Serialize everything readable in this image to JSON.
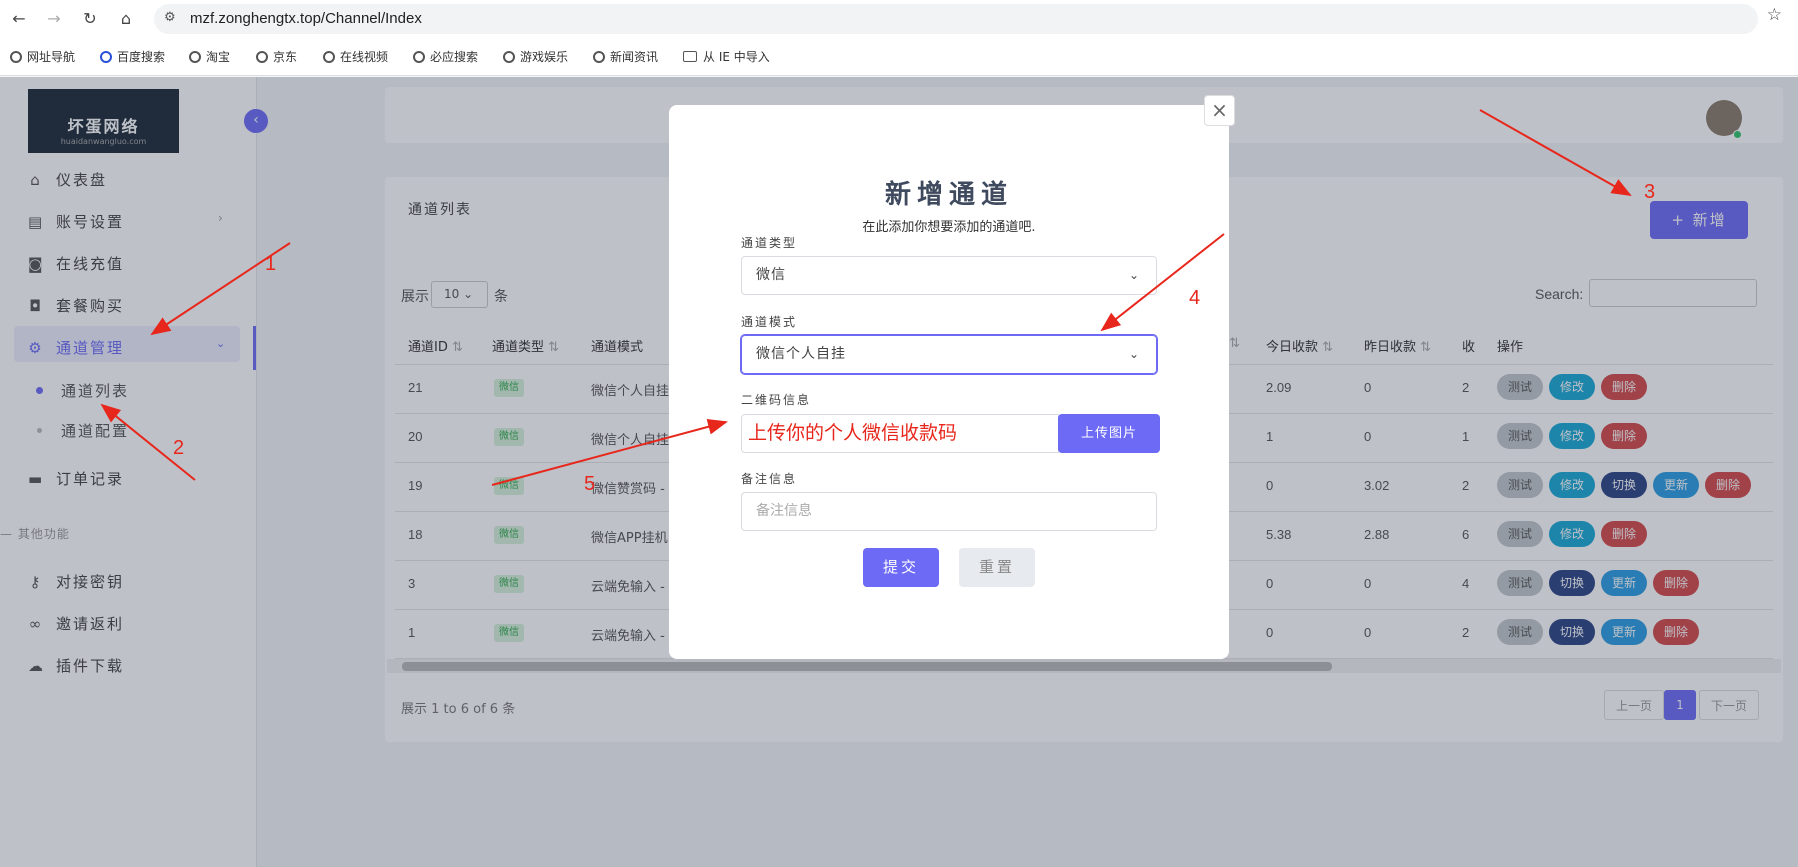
{
  "browser": {
    "url": "mzf.zonghengtx.top/Channel/Index",
    "bookmarks": [
      "网址导航",
      "百度搜索",
      "淘宝",
      "京东",
      "在线视频",
      "必应搜索",
      "游戏娱乐",
      "新闻资讯",
      "从 IE 中导入"
    ]
  },
  "sidebar": {
    "logo_text": "坏蛋网络",
    "logo_sub": "huaidanwangluo.com",
    "items": [
      {
        "label": "仪表盘"
      },
      {
        "label": "账号设置"
      },
      {
        "label": "在线充值"
      },
      {
        "label": "套餐购买"
      },
      {
        "label": "通道管理"
      }
    ],
    "sub_items": [
      {
        "label": "通道列表"
      },
      {
        "label": "通道配置"
      }
    ],
    "order_label": "订单记录",
    "section_label": "— 其他功能",
    "other_items": [
      {
        "label": "对接密钥"
      },
      {
        "label": "邀请返利"
      },
      {
        "label": "插件下载"
      }
    ]
  },
  "card": {
    "title": "通道列表",
    "add_button": "+ 新增",
    "show_label": "展示",
    "page_size": "10",
    "tiao": "条",
    "search_label": "Search:"
  },
  "table": {
    "headers": [
      "通道ID",
      "通道类型",
      "通道模式",
      "今日收款",
      "昨日收款",
      "收",
      "操作"
    ],
    "rows": [
      {
        "id": "21",
        "type": "微信",
        "mode": "微信个人自挂",
        "today": "2.09",
        "yesterday": "0",
        "count": "2"
      },
      {
        "id": "20",
        "type": "微信",
        "mode": "微信个人自挂",
        "today": "1",
        "yesterday": "0",
        "count": "1"
      },
      {
        "id": "19",
        "type": "微信",
        "mode": "微信赞赏码 -",
        "today": "0",
        "yesterday": "3.02",
        "count": "2"
      },
      {
        "id": "18",
        "type": "微信",
        "mode": "微信APP挂机",
        "today": "5.38",
        "yesterday": "2.88",
        "count": "6"
      },
      {
        "id": "3",
        "type": "微信",
        "mode": "云端免输入 -",
        "today": "0",
        "yesterday": "0",
        "count": "4"
      },
      {
        "id": "1",
        "type": "微信",
        "mode": "云端免输入 -",
        "today": "0",
        "yesterday": "0",
        "count": "2"
      }
    ],
    "btn_labels": {
      "test": "测试",
      "edit": "修改",
      "delete": "删除",
      "switch": "切换",
      "update": "更新"
    }
  },
  "footer": {
    "info": "展示 1 to 6 of 6 条",
    "prev": "上一页",
    "page": "1",
    "next": "下一页"
  },
  "modal": {
    "close": "×",
    "title": "新增通道",
    "subtitle": "在此添加你想要添加的通道吧.",
    "type_label": "通道类型",
    "type_value": "微信",
    "mode_label": "通道模式",
    "mode_value": "微信个人自挂",
    "qr_label": "二维码信息",
    "qr_placeholder": "上传你的个人微信收款码",
    "upload_button": "上传图片",
    "note_label": "备注信息",
    "note_placeholder": "备注信息",
    "submit": "提交",
    "reset": "重置"
  },
  "annotations": {
    "n1": "1",
    "n2": "2",
    "n3": "3",
    "n4": "4",
    "n5": "5",
    "qr_hint": "上传你的个人微信收款码",
    "color": "#e8271c"
  },
  "colors": {
    "accent": "#6d6af6"
  }
}
